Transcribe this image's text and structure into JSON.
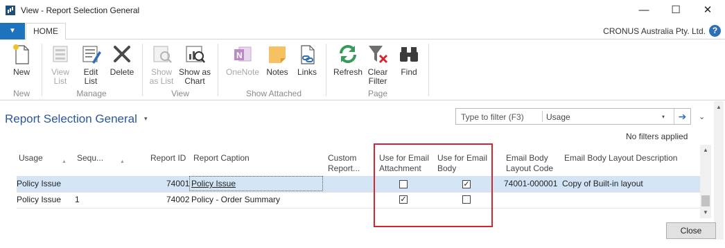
{
  "window": {
    "title": "View - Report Selection General",
    "minimize": "—",
    "maximize": "☐",
    "close": "✕"
  },
  "ribbon": {
    "menu_glyph": "▼",
    "tab_home": "HOME",
    "company": "CRONUS Australia Pty. Ltd.",
    "help": "?",
    "buttons": {
      "new": "New",
      "view_list_1": "View",
      "view_list_2": "List",
      "edit_list_1": "Edit",
      "edit_list_2": "List",
      "delete": "Delete",
      "show_as_list_1": "Show",
      "show_as_list_2": "as List",
      "show_as_chart_1": "Show as",
      "show_as_chart_2": "Chart",
      "onenote": "OneNote",
      "notes": "Notes",
      "links": "Links",
      "refresh": "Refresh",
      "clear_filter_1": "Clear",
      "clear_filter_2": "Filter",
      "find": "Find"
    },
    "groups": {
      "new": "New",
      "manage": "Manage",
      "view": "View",
      "show_attached": "Show Attached",
      "page": "Page"
    }
  },
  "page": {
    "title": "Report Selection General",
    "title_caret": "▾",
    "filter_placeholder": "Type to filter (F3)",
    "filter_field": "Usage",
    "filter_caret": "▾",
    "filter_go": "➔",
    "collapse": "⌄",
    "no_filters": "No filters applied"
  },
  "columns": {
    "usage": "Usage",
    "sequence": "Sequ...",
    "report_id": "Report ID",
    "report_caption": "Report Caption",
    "custom_report_1": "Custom",
    "custom_report_2": "Report...",
    "email_attachment_1": "Use for Email",
    "email_attachment_2": "Attachment",
    "email_body_1": "Use for Email",
    "email_body_2": "Body",
    "email_body_layout_code_1": "Email Body",
    "email_body_layout_code_2": "Layout Code",
    "email_body_layout_desc": "Email Body Layout Description"
  },
  "rows": [
    {
      "usage": "Policy Issue",
      "sequence": "",
      "report_id": "74001",
      "report_caption": "Policy Issue",
      "use_for_email_attachment": false,
      "use_for_email_body": true,
      "email_body_layout_code": "74001-000001",
      "email_body_layout_description": "Copy of Built-in layout"
    },
    {
      "usage": "Policy Issue",
      "sequence": "1",
      "report_id": "74002",
      "report_caption": "Policy - Order Summary",
      "use_for_email_attachment": true,
      "use_for_email_body": false,
      "email_body_layout_code": "",
      "email_body_layout_description": ""
    }
  ],
  "checkbox_checked_glyph": "✓",
  "footer": {
    "close_label": "Close"
  },
  "colors": {
    "accent": "#1e73be",
    "title_blue": "#2b579a",
    "selected_row": "#d3e4f5",
    "highlight_border": "#d0262d"
  }
}
